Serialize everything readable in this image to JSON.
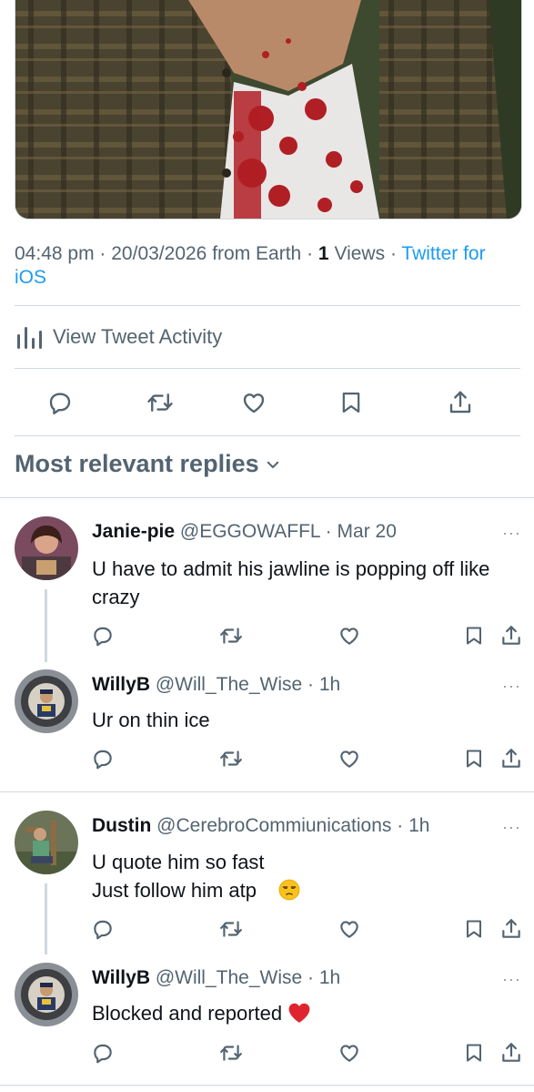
{
  "tweet": {
    "time": "04:48 pm",
    "date": "20/03/2026",
    "from_label": "from Earth",
    "views_count": "1",
    "views_label": "Views",
    "client": "Twitter for iOS",
    "separator": "·"
  },
  "activity": {
    "label": "View Tweet Activity",
    "icon": "bar-chart-icon"
  },
  "action_bar": [
    "reply-icon",
    "retweet-icon",
    "like-icon",
    "bookmark-icon",
    "share-icon"
  ],
  "replies_header": {
    "label": "Most relevant replies",
    "icon": "chevron-down-icon"
  },
  "replies": [
    {
      "name": "Janie-pie",
      "handle": "@EGGOWAFFL",
      "time": "Mar 20",
      "lines": [
        "U have to admit his jawline is popping off like",
        "crazy"
      ]
    },
    {
      "name": "WillyB",
      "handle": "@Will_The_Wise",
      "time": "1h",
      "lines": [
        "Ur on thin ice"
      ]
    },
    {
      "name": "Dustin",
      "handle": "@CerebroCommiunications",
      "time": "1h",
      "lines": [
        "U quote him so fast",
        "Just follow him atp"
      ],
      "emoji": "😒"
    },
    {
      "name": "WillyB",
      "handle": "@Will_The_Wise",
      "time": "1h",
      "lines": [
        "Blocked and reported"
      ],
      "emoji": "❤️"
    }
  ],
  "more_label": "···",
  "colors": {
    "link": "#1d9bf0",
    "secondary_text": "#536471",
    "divider": "#cfd9de",
    "primary_text": "#0f1419"
  }
}
